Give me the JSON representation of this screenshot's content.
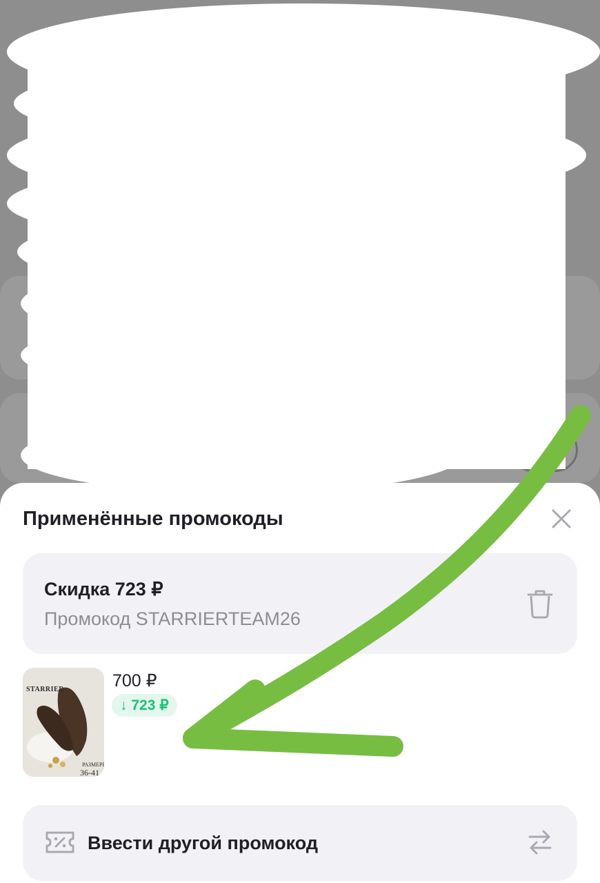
{
  "sheet": {
    "title": "Применённые промокоды",
    "close_icon": "close-icon"
  },
  "promo": {
    "discount": "Скидка 723 ₽",
    "code": "Промокод STARRIERTEAM26",
    "delete_icon": "trash-icon"
  },
  "product": {
    "price": "700 ₽",
    "discount": "↓ 723 ₽",
    "image": {
      "brand": "STARRIER",
      "sizes_label": "РАЗМЕРЫ",
      "sizes_range": "36-41"
    }
  },
  "enter_promo": {
    "label": "Ввести другой промокод",
    "left_icon": "ticket-percent-icon",
    "right_icon": "swap-icon"
  },
  "colors": {
    "discount_green": "#1fbf77",
    "arrow_green": "#77bd42"
  }
}
